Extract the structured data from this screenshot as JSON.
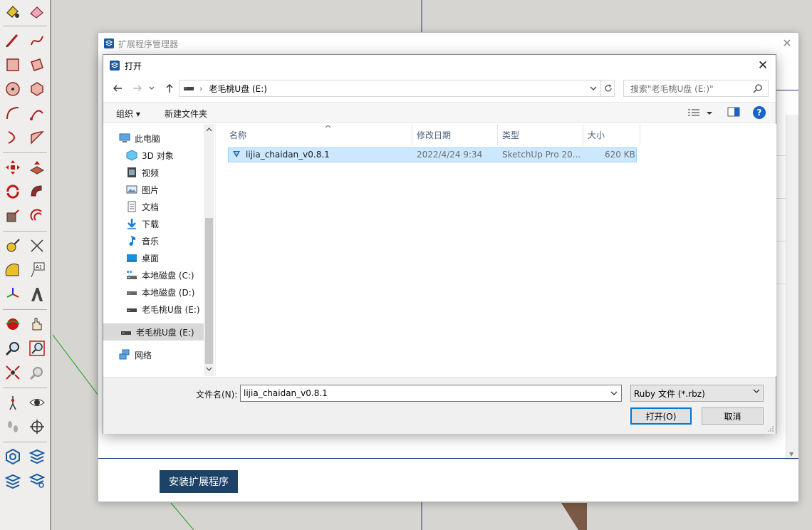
{
  "extension_manager": {
    "title": "扩展程序管理器",
    "close_glyph": "✕",
    "install_button": "安装扩展程序"
  },
  "open_dialog": {
    "title": "打开",
    "close_glyph": "✕",
    "address": {
      "path": "老毛桃U盘 (E:)",
      "search_placeholder": "搜索\"老毛桃U盘 (E:)\""
    },
    "commands": {
      "organize": "组织 ▾",
      "new_folder": "新建文件夹",
      "help": "?"
    },
    "nav_tree": [
      {
        "label": "此电脑",
        "icon": "computer-icon"
      },
      {
        "label": "3D 对象",
        "icon": "3d-objects-icon"
      },
      {
        "label": "视频",
        "icon": "video-icon"
      },
      {
        "label": "图片",
        "icon": "pictures-icon"
      },
      {
        "label": "文档",
        "icon": "documents-icon"
      },
      {
        "label": "下载",
        "icon": "download-icon"
      },
      {
        "label": "音乐",
        "icon": "music-icon"
      },
      {
        "label": "桌面",
        "icon": "desktop-icon"
      },
      {
        "label": "本地磁盘 (C:)",
        "icon": "system-drive-icon"
      },
      {
        "label": "本地磁盘 (D:)",
        "icon": "drive-icon"
      },
      {
        "label": "老毛桃U盘 (E:)",
        "icon": "usb-drive-icon"
      },
      {
        "label": "老毛桃U盘 (E:)",
        "icon": "usb-drive-icon",
        "selected": true
      },
      {
        "label": "网络",
        "icon": "network-icon"
      }
    ],
    "columns": {
      "name": "名称",
      "modified": "修改日期",
      "type": "类型",
      "size": "大小"
    },
    "files": [
      {
        "name": "lijia_chaidan_v0.8.1",
        "modified": "2022/4/24 9:34",
        "type": "SketchUp Pro 20...",
        "size": "620 KB",
        "selected": true
      }
    ],
    "filename_label": "文件名(N):",
    "filename_value": "lijia_chaidan_v0.8.1",
    "filetype": "Ruby 文件 (*.rbz)",
    "open_button": "打开(O)",
    "cancel_button": "取消"
  },
  "colors": {
    "selection": "#cce8ff",
    "accent": "#0078d7",
    "install_button": "#1c4268"
  }
}
